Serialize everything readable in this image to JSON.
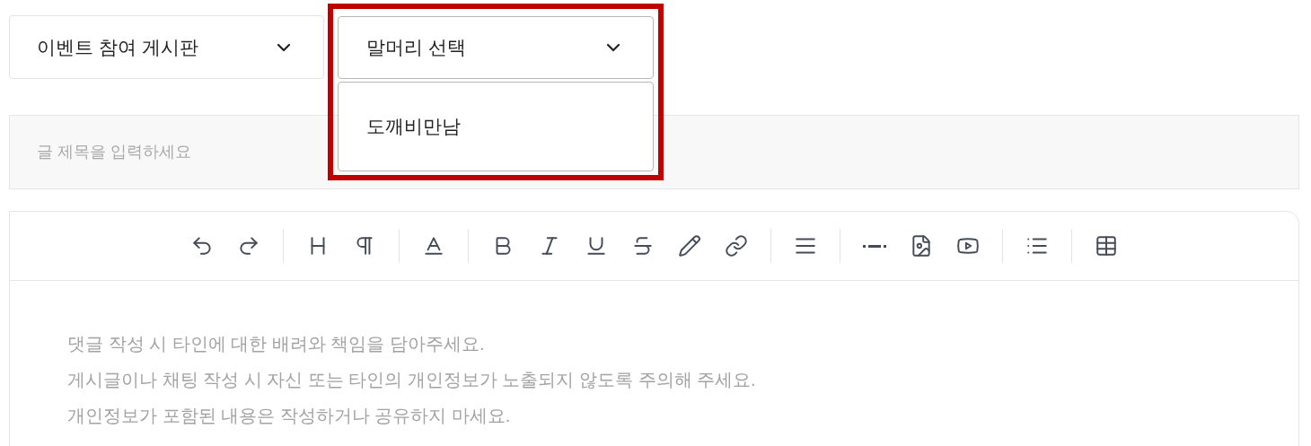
{
  "board_select": {
    "value": "이벤트 참여 게시판"
  },
  "header_select": {
    "value": "말머리 선택",
    "expanded": true,
    "highlighted": true,
    "options": [
      {
        "label": "도깨비만남"
      }
    ]
  },
  "title_field": {
    "placeholder": "글 제목을 입력하세요"
  },
  "editor": {
    "placeholder_lines": [
      "댓글 작성 시 타인에 대한 배려와 책임을 담아주세요.",
      "게시글이나 채팅 작성 시 자신 또는 타인의 개인정보가 노출되지 않도록 주의해 주세요.",
      "개인정보가 포함된 내용은 작성하거나 공유하지 마세요."
    ]
  }
}
